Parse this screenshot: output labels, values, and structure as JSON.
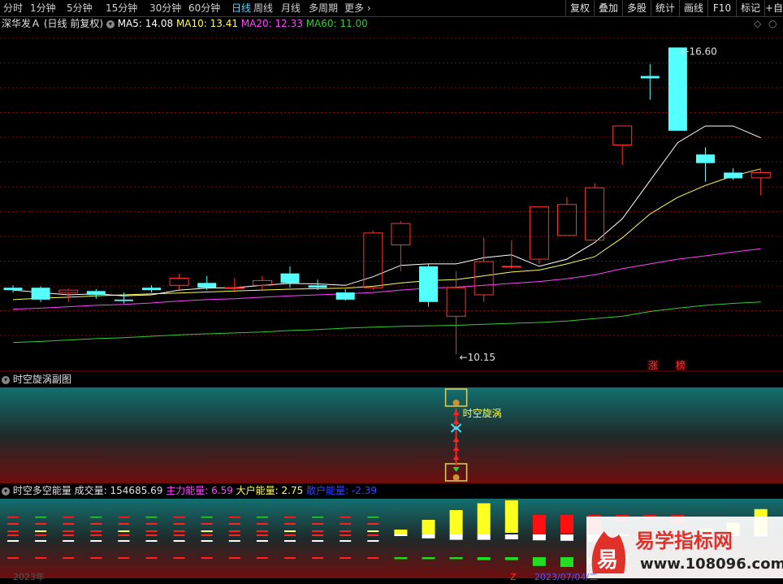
{
  "toolbar": {
    "periods": [
      "分时",
      "1分钟",
      "5分钟",
      "15分钟",
      "30分钟",
      "60分钟",
      "日线",
      "周线",
      "月线",
      "多周期",
      "更多"
    ],
    "active": "日线",
    "right_buttons": [
      "复权",
      "叠加",
      "多股",
      "统计",
      "画线",
      "F10",
      "标记",
      "+自"
    ]
  },
  "header": {
    "stock": "深华发Ａ",
    "mode": "(日线 前复权)",
    "ma5": "MA5: 14.08",
    "ma10": "MA10: 13.41",
    "ma20": "MA20: 12.33",
    "ma60": "MA60: 11.00"
  },
  "colors": {
    "up": "#ff3232",
    "down": "#54ffff",
    "ma5": "#ffffff",
    "ma10": "#ffff55",
    "ma20": "#ff44ff",
    "ma60": "#33cc33",
    "grid": "#8b0000"
  },
  "chart_data": [
    {
      "type": "candlestick",
      "title": "深华发Ａ (日线 前复权)",
      "ylim": [
        10.0,
        17.0
      ],
      "high_label": "16.60",
      "low_label": "10.15",
      "candles": [
        {
          "o": 11.55,
          "h": 11.6,
          "l": 11.45,
          "c": 11.5
        },
        {
          "o": 11.55,
          "h": 11.58,
          "l": 11.25,
          "c": 11.3
        },
        {
          "o": 11.45,
          "h": 11.53,
          "l": 11.25,
          "c": 11.5
        },
        {
          "o": 11.48,
          "h": 11.52,
          "l": 11.32,
          "c": 11.4
        },
        {
          "o": 11.3,
          "h": 11.45,
          "l": 11.22,
          "c": 11.27
        },
        {
          "o": 11.55,
          "h": 11.6,
          "l": 11.45,
          "c": 11.5
        },
        {
          "o": 11.6,
          "h": 11.85,
          "l": 11.5,
          "c": 11.75
        },
        {
          "o": 11.65,
          "h": 11.8,
          "l": 11.5,
          "c": 11.55
        },
        {
          "o": 11.55,
          "h": 11.75,
          "l": 11.45,
          "c": 11.55
        },
        {
          "o": 11.6,
          "h": 11.8,
          "l": 11.5,
          "c": 11.7
        },
        {
          "o": 11.85,
          "h": 12.0,
          "l": 11.55,
          "c": 11.65
        },
        {
          "o": 11.6,
          "h": 11.72,
          "l": 11.5,
          "c": 11.55
        },
        {
          "o": 11.45,
          "h": 11.52,
          "l": 11.28,
          "c": 11.3
        },
        {
          "o": 11.55,
          "h": 12.75,
          "l": 11.5,
          "c": 12.7
        },
        {
          "o": 12.45,
          "h": 12.95,
          "l": 11.9,
          "c": 12.9
        },
        {
          "o": 12.0,
          "h": 12.05,
          "l": 11.15,
          "c": 11.25
        },
        {
          "o": 10.95,
          "h": 11.9,
          "l": 10.15,
          "c": 11.55
        },
        {
          "o": 11.4,
          "h": 12.6,
          "l": 11.25,
          "c": 12.1
        },
        {
          "o": 12.0,
          "h": 12.55,
          "l": 11.95,
          "c": 12.0
        },
        {
          "o": 12.15,
          "h": 13.25,
          "l": 12.05,
          "c": 13.25
        },
        {
          "o": 12.65,
          "h": 13.45,
          "l": 12.65,
          "c": 13.3
        },
        {
          "o": 12.55,
          "h": 13.75,
          "l": 12.55,
          "c": 13.65
        },
        {
          "o": 14.55,
          "h": 14.95,
          "l": 14.13,
          "c": 14.95
        },
        {
          "o": 16.0,
          "h": 16.25,
          "l": 15.5,
          "c": 15.95
        },
        {
          "o": 16.6,
          "h": 16.6,
          "l": 14.85,
          "c": 14.85
        },
        {
          "o": 14.35,
          "h": 14.5,
          "l": 13.78,
          "c": 14.17
        },
        {
          "o": 13.97,
          "h": 14.06,
          "l": 13.82,
          "c": 13.85
        },
        {
          "o": 13.86,
          "h": 14.03,
          "l": 13.49,
          "c": 13.97
        }
      ],
      "ma5": [
        11.5,
        11.45,
        11.4,
        11.42,
        11.38,
        11.4,
        11.5,
        11.54,
        11.55,
        11.6,
        11.64,
        11.63,
        11.6,
        11.78,
        12.02,
        12.05,
        12.05,
        12.18,
        12.24,
        12.0,
        12.15,
        12.5,
        13.0,
        13.8,
        14.6,
        14.95,
        14.95,
        14.7
      ],
      "ma10": [
        11.3,
        11.33,
        11.35,
        11.38,
        11.4,
        11.42,
        11.44,
        11.46,
        11.48,
        11.5,
        11.52,
        11.53,
        11.54,
        11.58,
        11.65,
        11.7,
        11.72,
        11.8,
        11.88,
        11.92,
        12.05,
        12.2,
        12.6,
        13.1,
        13.45,
        13.7,
        13.9,
        14.05
      ],
      "ma20": [
        11.1,
        11.12,
        11.15,
        11.18,
        11.2,
        11.23,
        11.27,
        11.3,
        11.32,
        11.35,
        11.38,
        11.4,
        11.42,
        11.45,
        11.5,
        11.54,
        11.56,
        11.6,
        11.64,
        11.68,
        11.74,
        11.82,
        11.95,
        12.05,
        12.15,
        12.22,
        12.3,
        12.37
      ],
      "ma60": [
        10.4,
        10.42,
        10.45,
        10.48,
        10.5,
        10.53,
        10.56,
        10.58,
        10.6,
        10.62,
        10.65,
        10.67,
        10.7,
        10.72,
        10.74,
        10.75,
        10.76,
        10.78,
        10.8,
        10.82,
        10.85,
        10.9,
        10.95,
        11.05,
        11.12,
        11.18,
        11.22,
        11.25
      ]
    },
    {
      "type": "signal",
      "title": "时空旋涡副图",
      "signal_label": "时空旋涡",
      "signal_index": 16
    },
    {
      "type": "bar",
      "title": "时空多空能量",
      "series": [
        {
          "name": "成交量",
          "value": "154685.69"
        },
        {
          "name": "主力能量",
          "value": "6.59"
        },
        {
          "name": "大户能量",
          "value": "2.75"
        },
        {
          "name": "散户能量",
          "value": "-2.39"
        }
      ],
      "main_energy": [
        -0.3,
        -0.3,
        -0.3,
        -0.3,
        -0.3,
        -0.3,
        -0.3,
        -0.3,
        -0.3,
        -0.3,
        -0.3,
        -0.3,
        -0.3,
        -0.3,
        0.5,
        1.5,
        2.5,
        3.2,
        3.5,
        -2.3,
        -1.9,
        -1.8,
        -0.6,
        -0.4,
        -0.9,
        0.6,
        1.2,
        2.6
      ],
      "big_energy": [
        -0.1,
        -0.1,
        -0.1,
        -0.1,
        -0.1,
        -0.1,
        -0.1,
        -0.1,
        -0.1,
        -0.1,
        -0.1,
        -0.1,
        -0.1,
        -0.1,
        -0.2,
        -0.2,
        -0.2,
        -0.3,
        -0.3,
        -0.9,
        -1.0,
        -0.7,
        -0.1,
        0.2,
        0.3,
        0.3,
        0.4,
        0.4
      ],
      "retail_energy": [
        0.2,
        0.2,
        0.2,
        0.2,
        0.2,
        0.2,
        0.2,
        0.2,
        0.2,
        0.2,
        0.2,
        0.2,
        0.2,
        0.2,
        0.3,
        0.8,
        1.1,
        1.1,
        1.0,
        -1.2,
        -1.3,
        -1.5,
        -0.3,
        -0.2,
        -0.2,
        -0.3,
        -0.3,
        -0.4
      ]
    }
  ],
  "panels": {
    "vortex_title": "时空旋涡副图",
    "energy_title": "时空多空能量",
    "energy_vol": "成交量: 154685.69",
    "energy_main": "主力能量: 6.59",
    "energy_big": "大户能量: 2.75",
    "energy_retail": "散户能量: -2.39"
  },
  "tags": [
    "涨",
    "榜"
  ],
  "bottom": {
    "left_date": "2023年",
    "marker": "Z",
    "right_date": "2023/07/04/二"
  },
  "logo": {
    "cn": "易学指标网",
    "url": "www.108096.com",
    "glyph": "易"
  }
}
